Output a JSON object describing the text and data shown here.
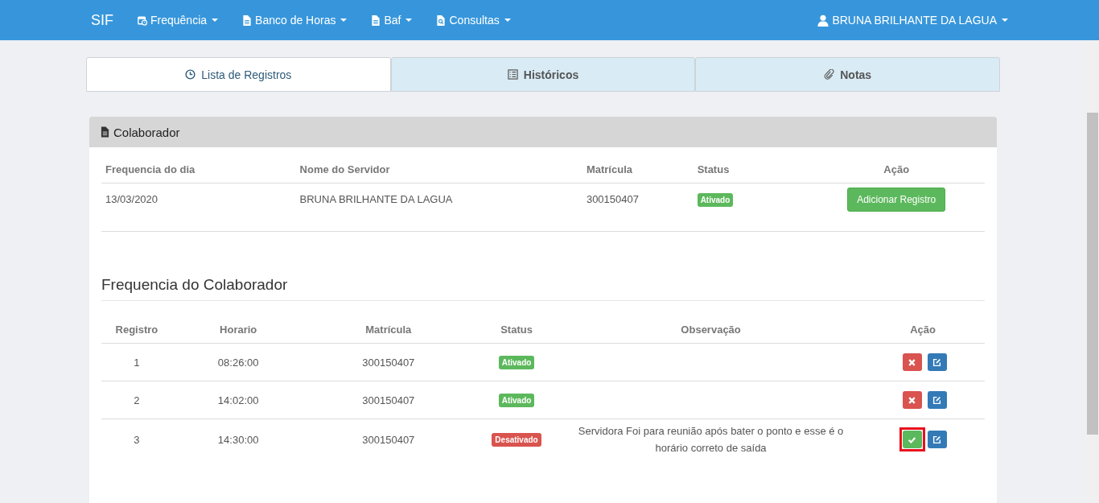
{
  "navbar": {
    "brand": "SIF",
    "menus": [
      {
        "label": "Frequência",
        "kind": "calendar"
      },
      {
        "label": "Banco de Horas",
        "kind": "file"
      },
      {
        "label": "Baf",
        "kind": "file"
      },
      {
        "label": "Consultas",
        "kind": "search-file"
      }
    ],
    "user": "BRUNA BRILHANTE DA LAGUA"
  },
  "tabs": [
    {
      "label": "Lista de Registros",
      "kind": "clock",
      "selected": true
    },
    {
      "label": "Históricos",
      "kind": "list",
      "selected": false
    },
    {
      "label": "Notas",
      "kind": "paperclip",
      "selected": false
    }
  ],
  "panel": {
    "title": "Colaborador",
    "summary": {
      "columns": [
        "Frequencia do dia",
        "Nome do Servidor",
        "Matrícula",
        "Status",
        "Ação"
      ],
      "row": {
        "date": "13/03/2020",
        "name": "BRUNA BRILHANTE DA LAGUA",
        "matricula": "300150407",
        "status": {
          "label": "Ativado",
          "kind": "active"
        },
        "action": "Adicionar Registro"
      }
    },
    "section_title": "Frequencia do Colaborador",
    "records": {
      "columns": [
        "Registro",
        "Horario",
        "Matrícula",
        "Status",
        "Observação",
        "Ação"
      ],
      "rows": [
        {
          "registro": "1",
          "horario": "08:26:00",
          "matricula": "300150407",
          "status": {
            "label": "Ativado",
            "kind": "active"
          },
          "observacao": "",
          "action": {
            "kind": "delete"
          },
          "highlighted": false
        },
        {
          "registro": "2",
          "horario": "14:02:00",
          "matricula": "300150407",
          "status": {
            "label": "Ativado",
            "kind": "active"
          },
          "observacao": "",
          "action": {
            "kind": "delete"
          },
          "highlighted": false
        },
        {
          "registro": "3",
          "horario": "14:30:00",
          "matricula": "300150407",
          "status": {
            "label": "Desativado",
            "kind": "inactive"
          },
          "observacao": "Servidora Foi para reunião após bater o ponto e esse é o horário correto de saída",
          "action": {
            "kind": "activate"
          },
          "highlighted": true
        }
      ]
    }
  }
}
